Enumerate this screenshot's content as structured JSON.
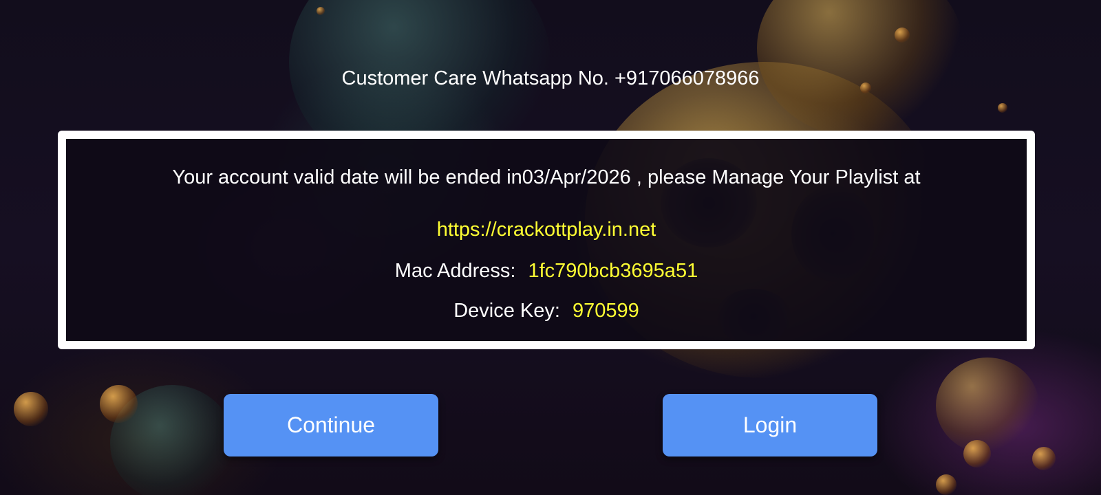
{
  "header": {
    "customer_care": "Customer Care Whatsapp No. +917066078966"
  },
  "panel": {
    "message": "Your account valid date will be ended in03/Apr/2026 , please Manage Your Playlist at",
    "url": "https://crackottplay.in.net",
    "mac_label": "Mac Address:",
    "mac_value": "1fc790bcb3695a51",
    "key_label": "Device Key:",
    "key_value": "970599"
  },
  "buttons": {
    "continue_label": "Continue",
    "login_label": "Login"
  },
  "colors": {
    "accent_yellow": "#ffff33",
    "button_blue": "#5592f4",
    "border_white": "#ffffff"
  }
}
